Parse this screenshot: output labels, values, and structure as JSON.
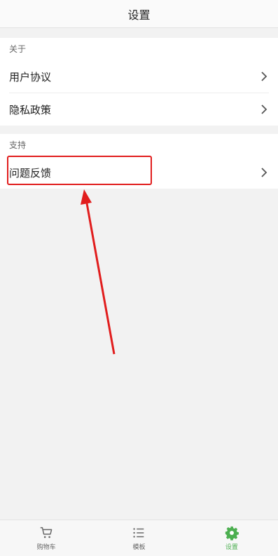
{
  "header": {
    "title": "设置"
  },
  "sections": [
    {
      "title": "关于",
      "items": [
        "用户协议",
        "隐私政策"
      ]
    },
    {
      "title": "支持",
      "items": [
        "问题反馈"
      ]
    }
  ],
  "tabbar": {
    "tabs": [
      {
        "label": "购物车",
        "icon": "cart-icon"
      },
      {
        "label": "模板",
        "icon": "list-icon"
      },
      {
        "label": "设置",
        "icon": "gear-icon"
      }
    ],
    "active_index": 2
  },
  "colors": {
    "accent": "#4caf50",
    "annotation": "#e11d1d"
  }
}
